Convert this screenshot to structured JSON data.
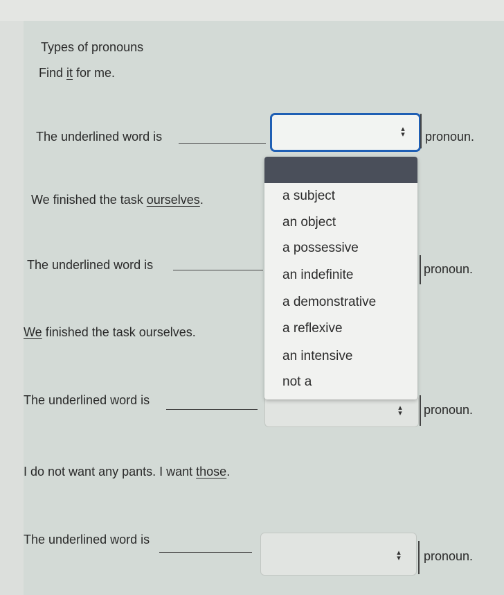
{
  "page": {
    "title": "Types of pronouns",
    "instruction": {
      "pre": "Find ",
      "underlined": "it",
      "post": " for me."
    }
  },
  "questions": [
    {
      "prompt_label": "The underlined word is",
      "suffix": "pronoun."
    },
    {
      "sentence": {
        "pre": "We finished the task ",
        "underlined": "ourselves",
        "post": "."
      },
      "prompt_label": "The underlined word is",
      "suffix": "pronoun."
    },
    {
      "sentence": {
        "pre": "",
        "underlined": "We",
        "post": " finished the task ourselves."
      },
      "prompt_label": "The underlined word is",
      "suffix": "pronoun."
    },
    {
      "sentence": {
        "pre": "I do not want any pants. I want ",
        "underlined": "those",
        "post": "."
      },
      "prompt_label": "The underlined word is",
      "suffix": "pronoun."
    }
  ],
  "dropdown": {
    "options": [
      "a subject",
      "an object",
      "a possessive",
      "an indefinite",
      "a demonstrative",
      "a reflexive",
      "an intensive",
      "not a"
    ]
  },
  "colors": {
    "focus_border": "#1f5fb4",
    "dropdown_header": "#4a4f5a"
  }
}
